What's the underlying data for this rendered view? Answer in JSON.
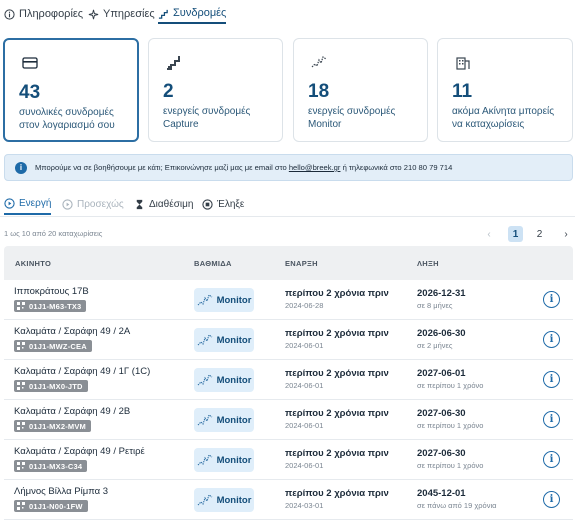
{
  "top_tabs": [
    {
      "label": "Πληροφορίες",
      "icon": "info-circle-icon"
    },
    {
      "label": "Υπηρεσίες",
      "icon": "sparkles-icon"
    },
    {
      "label": "Συνδρομές",
      "icon": "stairs-icon",
      "active": true
    }
  ],
  "cards": [
    {
      "count": "43",
      "line1": "συνολικές συνδρομές",
      "line2": "στον λογαριασμό σου",
      "icon": "credit-card-icon"
    },
    {
      "count": "2",
      "line1": "ενεργείς συνδρομές",
      "line2": "Capture",
      "icon": "stairs-icon"
    },
    {
      "count": "18",
      "line1": "ενεργείς συνδρομές",
      "line2": "Monitor",
      "icon": "monitor-pulse-icon"
    },
    {
      "count": "11",
      "line1": "ακόμα Ακίνητα μπορείς",
      "line2": "να καταχωρίσεις",
      "icon": "building-icon"
    }
  ],
  "banner": {
    "text_before": "Μπορούμε να σε βοηθήσουμε με κάτι; Επικοινώνησε μαζί μας με email στο",
    "email": "hello@breek.gr",
    "text_after": "ή τηλεφωνικά στο 210 80 79 714"
  },
  "status_tabs": [
    {
      "label": "Ενεργή",
      "icon": "play-circle-icon",
      "state": "active"
    },
    {
      "label": "Προσεχώς",
      "icon": "play-circle-icon",
      "state": "disabled"
    },
    {
      "label": "Διαθέσιμη",
      "icon": "hourglass-icon",
      "state": "normal"
    },
    {
      "label": "Έληξε",
      "icon": "stop-circle-icon",
      "state": "normal"
    }
  ],
  "pagination": {
    "range_text": "1 ως 10 από 20 καταχωρίσεις",
    "prev": "‹",
    "pages": [
      "1",
      "2"
    ],
    "current": "1",
    "next": "›"
  },
  "table": {
    "headers": [
      "ΑΚΙΝΗΤΟ",
      "ΒΑΘΜΙΔΑ",
      "ΕΝΑΡΞΗ",
      "ΛΗΞΗ"
    ],
    "rows": [
      {
        "name": "Ιπποκράτους 17Β",
        "code": "01J1-M63-TX3",
        "grade": "Monitor",
        "start_rel": "περίπου 2 χρόνια πριν",
        "start_date": "2024-06-28",
        "end_date": "2026-12-31",
        "end_rel": "σε 8 μήνες"
      },
      {
        "name": "Καλαμάτα / Σαράφη 49 / 2Α",
        "code": "01J1-MWZ-CEA",
        "grade": "Monitor",
        "start_rel": "περίπου 2 χρόνια πριν",
        "start_date": "2024-06-01",
        "end_date": "2026-06-30",
        "end_rel": "σε 2 μήνες"
      },
      {
        "name": "Καλαμάτα / Σαράφη 49 / 1Γ (1C)",
        "code": "01J1-MX0-JTD",
        "grade": "Monitor",
        "start_rel": "περίπου 2 χρόνια πριν",
        "start_date": "2024-06-01",
        "end_date": "2027-06-01",
        "end_rel": "σε περίπου 1 χρόνο"
      },
      {
        "name": "Καλαμάτα / Σαράφη 49 / 2Β",
        "code": "01J1-MX2-MVM",
        "grade": "Monitor",
        "start_rel": "περίπου 2 χρόνια πριν",
        "start_date": "2024-06-01",
        "end_date": "2027-06-30",
        "end_rel": "σε περίπου 1 χρόνο"
      },
      {
        "name": "Καλαμάτα / Σαράφη 49 / Ρετιρέ",
        "code": "01J1-MX3-C34",
        "grade": "Monitor",
        "start_rel": "περίπου 2 χρόνια πριν",
        "start_date": "2024-06-01",
        "end_date": "2027-06-30",
        "end_rel": "σε περίπου 1 χρόνο"
      },
      {
        "name": "Λήμνος Βίλλα Ρίμπα 3",
        "code": "01J1-N00-1FW",
        "grade": "Monitor",
        "start_rel": "περίπου 2 χρόνια πριν",
        "start_date": "2024-03-01",
        "end_date": "2045-12-01",
        "end_rel": "σε πάνω από 19 χρόνια"
      }
    ]
  },
  "colors": {
    "primary": "#144e7a",
    "accent": "#1e6aa8",
    "badge": "#8a8f95",
    "grade_bg": "#dfeefa",
    "banner_bg": "#e3eef8"
  }
}
